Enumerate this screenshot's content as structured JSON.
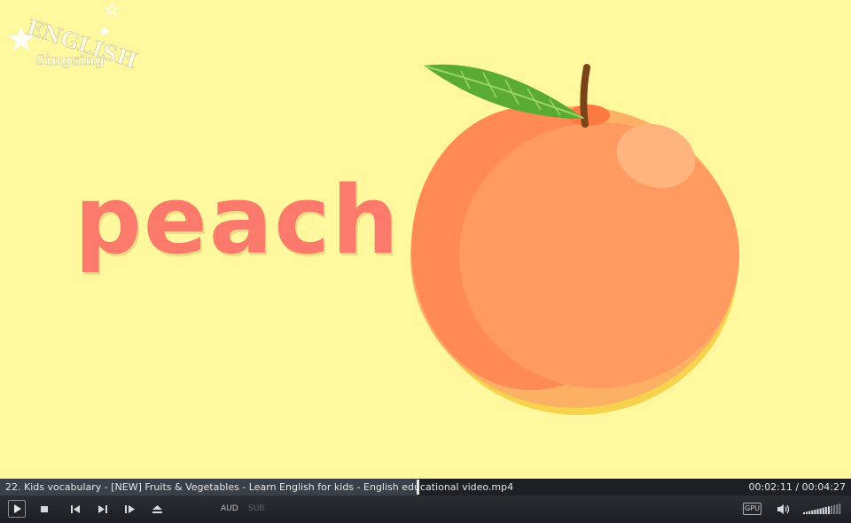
{
  "video": {
    "logo": {
      "line1": "ENGLISH",
      "line2": "Singsing"
    },
    "word": "peach"
  },
  "player": {
    "file_title": "22. Kids vocabulary - [NEW] Fruits & Vegetables - Learn English for kids - English educational video.mp4",
    "time": "00:02:11 / 00:04:27",
    "progress": 0.4906,
    "volume_level": 0.7,
    "aud_label": "AUD",
    "sub_label": "SUB",
    "gpu_label": "GPU",
    "icons": [
      "play-icon",
      "stop-icon",
      "previous-icon",
      "next-icon",
      "frame-step-icon",
      "eject-icon",
      "speaker-icon"
    ]
  },
  "colors": {
    "background": "#fff89e",
    "word": "#fc7a6b",
    "peach": "#ff9a5e",
    "leaf": "#5aab36"
  }
}
